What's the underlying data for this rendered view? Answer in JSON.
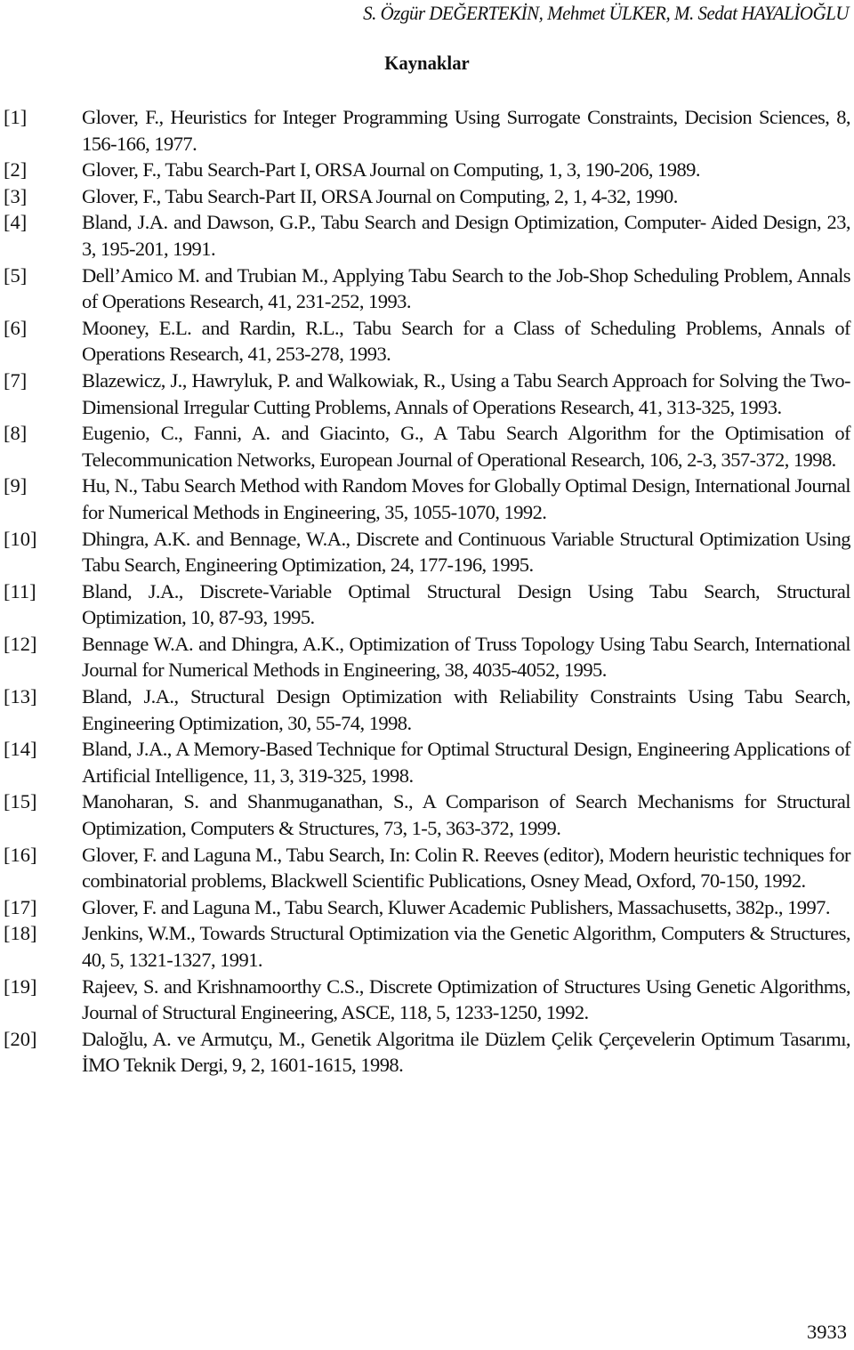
{
  "header": {
    "authors": "S. Özgür DEĞERTEKİN, Mehmet ÜLKER, M. Sedat HAYALİOĞLU"
  },
  "section": {
    "title": "Kaynaklar"
  },
  "references": [
    {
      "num": "[1]",
      "text": "Glover, F., Heuristics for Integer Programming Using Surrogate Constraints, Decision Sciences, 8, 156-166, 1977."
    },
    {
      "num": "[2]",
      "text": "Glover, F., Tabu Search-Part I, ORSA Journal on Computing, 1, 3, 190-206, 1989."
    },
    {
      "num": "[3]",
      "text": "Glover, F., Tabu Search-Part II, ORSA Journal on Computing, 2, 1, 4-32, 1990."
    },
    {
      "num": "[4]",
      "text": "Bland, J.A. and Dawson, G.P., Tabu Search and Design Optimization, Computer- Aided Design, 23, 3, 195-201, 1991."
    },
    {
      "num": "[5]",
      "text": "Dell’Amico M. and Trubian M., Applying Tabu Search to the Job-Shop Scheduling Problem,  Annals of Operations Research, 41, 231-252, 1993."
    },
    {
      "num": "[6]",
      "text": "Mooney, E.L. and Rardin, R.L., Tabu Search for a Class of Scheduling Problems, Annals of Operations Research, 41, 253-278, 1993."
    },
    {
      "num": "[7]",
      "text": "Blazewicz, J., Hawryluk, P. and Walkowiak, R., Using a Tabu Search Approach for Solving the Two-Dimensional Irregular Cutting Problems, Annals of Operations Research, 41, 313-325, 1993."
    },
    {
      "num": "[8]",
      "text": "Eugenio, C., Fanni, A. and Giacinto, G., A Tabu Search Algorithm for the Optimisation of Telecommunication Networks, European Journal of Operational Research, 106, 2-3, 357-372, 1998."
    },
    {
      "num": "[9]",
      "text": "Hu, N., Tabu Search Method with Random Moves for Globally Optimal Design, International Journal for Numerical Methods in Engineering, 35, 1055-1070, 1992."
    },
    {
      "num": "[10]",
      "text": "Dhingra, A.K. and Bennage, W.A., Discrete and Continuous Variable Structural Optimization Using Tabu Search, Engineering Optimization, 24, 177-196, 1995."
    },
    {
      "num": "[11]",
      "text": "Bland, J.A., Discrete-Variable Optimal Structural Design Using Tabu Search, Structural Optimization, 10, 87-93, 1995."
    },
    {
      "num": "[12]",
      "text": "Bennage W.A. and Dhingra, A.K., Optimization of  Truss Topology Using Tabu Search,  International Journal for Numerical Methods in Engineering, 38, 4035-4052, 1995."
    },
    {
      "num": "[13]",
      "text": "Bland, J.A., Structural Design Optimization with Reliability Constraints Using Tabu Search, Engineering Optimization, 30, 55-74, 1998."
    },
    {
      "num": "[14]",
      "text": "Bland, J.A., A Memory-Based Technique for Optimal Structural Design, Engineering Applications of Artificial Intelligence, 11, 3, 319-325, 1998."
    },
    {
      "num": "[15]",
      "text": "Manoharan, S. and Shanmuganathan, S., A Comparison of Search Mechanisms for Structural Optimization, Computers & Structures, 73, 1-5, 363-372, 1999."
    },
    {
      "num": "[16]",
      "text": "Glover, F. and Laguna M., Tabu Search, In:  Colin R. Reeves (editor), Modern heuristic techniques for combinatorial problems, Blackwell Scientific Publications, Osney Mead, Oxford, 70-150, 1992."
    },
    {
      "num": "[17]",
      "text": "Glover, F. and Laguna M., Tabu Search, Kluwer Academic Publishers, Massachusetts, 382p., 1997."
    },
    {
      "num": "[18]",
      "text": "Jenkins, W.M., Towards Structural Optimization via the Genetic Algorithm, Computers & Structures, 40, 5, 1321-1327, 1991."
    },
    {
      "num": "[19]",
      "text": "Rajeev, S. and Krishnamoorthy C.S., Discrete Optimization of Structures Using Genetic Algorithms,  Journal of Structural Engineering, ASCE, 118, 5, 1233-1250, 1992."
    },
    {
      "num": "[20]",
      "text": "Daloğlu, A. ve Armutçu, M., Genetik Algoritma ile Düzlem Çelik Çerçevelerin Optimum Tasarımı, İMO Teknik Dergi, 9,  2, 1601-1615, 1998."
    }
  ],
  "footer": {
    "page_number": "3933"
  }
}
